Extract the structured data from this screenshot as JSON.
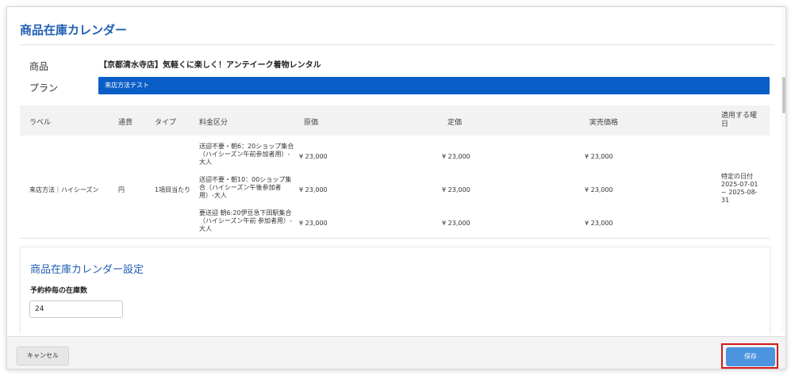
{
  "page": {
    "title": "商品在庫カレンダー"
  },
  "product": {
    "label": "商品",
    "value": "【京都清水寺店】気軽くに楽しく！アンテイーク着物レンタル"
  },
  "plan": {
    "label": "プラン",
    "value": "来店方法テスト"
  },
  "table": {
    "headers": {
      "label": "ラベル",
      "currency": "通貨",
      "type": "タイプ",
      "fee_category": "料金区分",
      "original_price": "原価",
      "list_price": "定価",
      "actual_price": "実売価格",
      "applicable_day": "適用する曜日"
    },
    "row": {
      "label": "来店方法｜ハイシーズン",
      "currency": "円",
      "type": "1項目当たり",
      "applicable_day": "特定の日付 2025-07-01 ~ 2025-08-31",
      "fees": [
        {
          "category": "送迎不要・朝6：20ショップ集合（ハイシーズン午前参加者用）-大人",
          "original_price": "¥ 23,000",
          "list_price": "¥ 23,000",
          "actual_price": "¥ 23,000"
        },
        {
          "category": "送迎不要・朝10：00ショップ集合（ハイシーズン午後参加者用）-大人",
          "original_price": "¥ 23,000",
          "list_price": "¥ 23,000",
          "actual_price": "¥ 23,000"
        },
        {
          "category": "要送迎 朝6:20伊豆急下田駅集合（ハイシーズン午前 参加者用）-大人",
          "original_price": "¥ 23,000",
          "list_price": "¥ 23,000",
          "actual_price": "¥ 23,000"
        }
      ]
    }
  },
  "settings": {
    "title": "商品在庫カレンダー設定",
    "stock_label": "予約枠毎の在庫数",
    "stock_value": "24"
  },
  "footer": {
    "cancel_label": "キャンセル",
    "save_label": "保存"
  },
  "colors": {
    "accent": "#1f5fb4",
    "plan_bar": "#0a5ec7",
    "save_button": "#4d94e0",
    "highlight_frame": "#d01a1a"
  }
}
